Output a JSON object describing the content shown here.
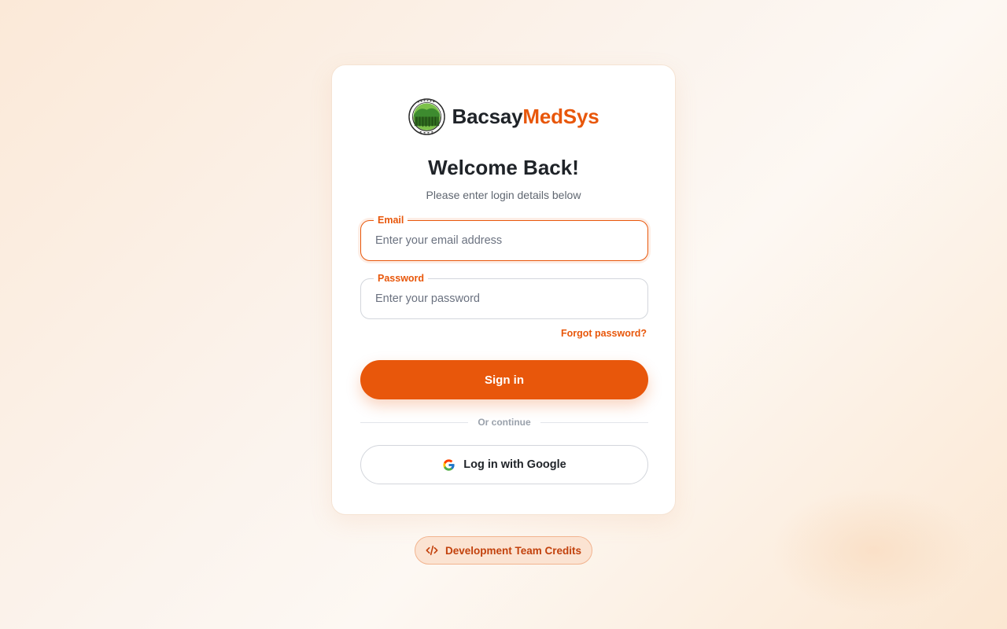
{
  "brand": {
    "name_part1": "Bacsay",
    "name_part2": "MedSys",
    "logo_icon": "municipal-seal-logo",
    "accent_color": "#e8570b"
  },
  "login": {
    "title": "Welcome Back!",
    "subtitle": "Please enter login details below",
    "email": {
      "label": "Email",
      "placeholder": "Enter your email address",
      "value": ""
    },
    "password": {
      "label": "Password",
      "placeholder": "Enter your password",
      "value": ""
    },
    "forgot_label": "Forgot password?",
    "signin_label": "Sign in",
    "divider_label": "Or continue",
    "google_label": "Log in with Google",
    "google_icon": "google-icon"
  },
  "footer": {
    "credits_label": "Development Team Credits",
    "credits_icon": "code-icon"
  }
}
